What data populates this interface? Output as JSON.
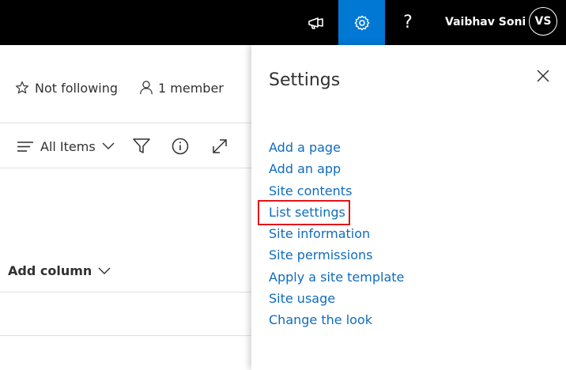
{
  "topbar": {
    "user_name": "Vaibhav Soni",
    "avatar_initials": "VS",
    "help_label": "?",
    "accent_color": "#0078d4"
  },
  "list": {
    "follow_label": "Not following",
    "member_label": "1 member",
    "view_label": "All Items",
    "add_column_label": "Add column"
  },
  "settings": {
    "title": "Settings",
    "items": [
      {
        "label": "Add a page"
      },
      {
        "label": "Add an app"
      },
      {
        "label": "Site contents"
      },
      {
        "label": "List settings",
        "highlighted": true
      },
      {
        "label": "Site information"
      },
      {
        "label": "Site permissions"
      },
      {
        "label": "Apply a site template"
      },
      {
        "label": "Site usage"
      },
      {
        "label": "Change the look"
      }
    ],
    "link_color": "#0f6cbd",
    "highlight_color": "#e0161b"
  }
}
